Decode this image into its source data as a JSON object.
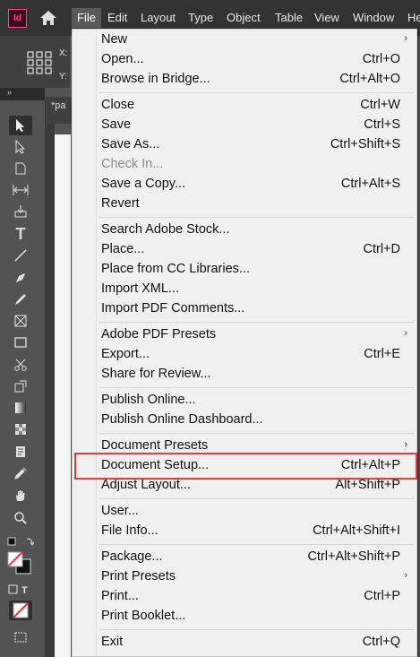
{
  "app": {
    "logo_text": "Id"
  },
  "menubar": {
    "items": [
      "File",
      "Edit",
      "Layout",
      "Type",
      "Object",
      "Table",
      "View",
      "Window",
      "He"
    ],
    "active": "File"
  },
  "control_bar": {
    "x_label": "X:",
    "y_label": "Y:"
  },
  "document_tab": {
    "label": "*pa"
  },
  "colors": {
    "accent_highlight": "#e5393f",
    "menu_bg": "#f0f0f0",
    "menubar_bg": "#323232",
    "app_brand": "#ff3f94"
  },
  "file_menu": {
    "groups": [
      [
        {
          "label": "New",
          "shortcut": "",
          "submenu": true
        },
        {
          "label": "Open...",
          "shortcut": "Ctrl+O"
        },
        {
          "label": "Browse in Bridge...",
          "shortcut": "Ctrl+Alt+O"
        }
      ],
      [
        {
          "label": "Close",
          "shortcut": "Ctrl+W"
        },
        {
          "label": "Save",
          "shortcut": "Ctrl+S"
        },
        {
          "label": "Save As...",
          "shortcut": "Ctrl+Shift+S"
        },
        {
          "label": "Check In...",
          "shortcut": "",
          "disabled": true
        },
        {
          "label": "Save a Copy...",
          "shortcut": "Ctrl+Alt+S"
        },
        {
          "label": "Revert",
          "shortcut": ""
        }
      ],
      [
        {
          "label": "Search Adobe Stock...",
          "shortcut": ""
        },
        {
          "label": "Place...",
          "shortcut": "Ctrl+D"
        },
        {
          "label": "Place from CC Libraries...",
          "shortcut": ""
        },
        {
          "label": "Import XML...",
          "shortcut": ""
        },
        {
          "label": "Import PDF Comments...",
          "shortcut": ""
        }
      ],
      [
        {
          "label": "Adobe PDF Presets",
          "shortcut": "",
          "submenu": true
        },
        {
          "label": "Export...",
          "shortcut": "Ctrl+E"
        },
        {
          "label": "Share for Review...",
          "shortcut": ""
        }
      ],
      [
        {
          "label": "Publish Online...",
          "shortcut": ""
        },
        {
          "label": "Publish Online Dashboard...",
          "shortcut": ""
        }
      ],
      [
        {
          "label": "Document Presets",
          "shortcut": "",
          "submenu": true
        },
        {
          "label": "Document Setup...",
          "shortcut": "Ctrl+Alt+P",
          "highlighted": true
        },
        {
          "label": "Adjust Layout...",
          "shortcut": "Alt+Shift+P"
        }
      ],
      [
        {
          "label": "User...",
          "shortcut": ""
        },
        {
          "label": "File Info...",
          "shortcut": "Ctrl+Alt+Shift+I"
        }
      ],
      [
        {
          "label": "Package...",
          "shortcut": "Ctrl+Alt+Shift+P"
        },
        {
          "label": "Print Presets",
          "shortcut": "",
          "submenu": true
        },
        {
          "label": "Print...",
          "shortcut": "Ctrl+P"
        },
        {
          "label": "Print Booklet...",
          "shortcut": ""
        }
      ],
      [
        {
          "label": "Exit",
          "shortcut": "Ctrl+Q"
        }
      ]
    ]
  },
  "tools": [
    "selection-tool",
    "direct-selection-tool",
    "page-tool",
    "gap-tool",
    "content-collector-tool",
    "type-tool",
    "line-tool",
    "pen-tool",
    "pencil-tool",
    "rectangle-frame-tool",
    "rectangle-tool",
    "scissors-tool",
    "free-transform-tool",
    "gradient-swatch-tool",
    "gradient-feather-tool",
    "note-tool",
    "eyedropper-tool",
    "hand-tool",
    "zoom-tool"
  ]
}
